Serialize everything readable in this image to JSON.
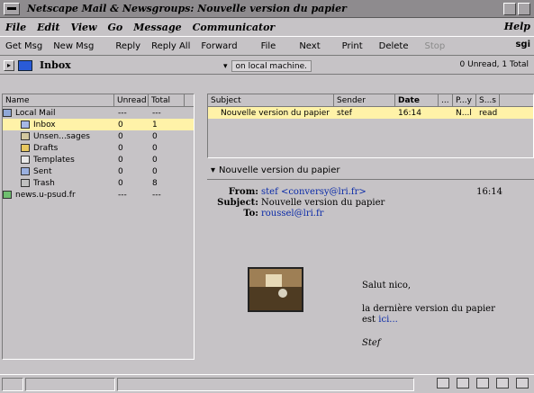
{
  "window": {
    "title": "Netscape Mail & Newsgroups: Nouvelle version du papier"
  },
  "menu": {
    "items": [
      "File",
      "Edit",
      "View",
      "Go",
      "Message",
      "Communicator"
    ],
    "help": "Help"
  },
  "toolbar": {
    "buttons": [
      "Get Msg",
      "New Msg",
      "Reply",
      "Reply All",
      "Forward",
      "File",
      "Next",
      "Print",
      "Delete",
      "Stop"
    ],
    "logo": "sgi"
  },
  "folderbar": {
    "folder": "Inbox",
    "host": "on local machine.",
    "counts": "0 Unread, 1 Total"
  },
  "folders": {
    "headers": [
      "Name",
      "Unread",
      "Total"
    ],
    "rows": [
      {
        "name": "Local Mail",
        "unread": "---",
        "total": "---"
      },
      {
        "name": "Inbox",
        "unread": "0",
        "total": "1"
      },
      {
        "name": "Unsen...sages",
        "unread": "0",
        "total": "0"
      },
      {
        "name": "Drafts",
        "unread": "0",
        "total": "0"
      },
      {
        "name": "Templates",
        "unread": "0",
        "total": "0"
      },
      {
        "name": "Sent",
        "unread": "0",
        "total": "0"
      },
      {
        "name": "Trash",
        "unread": "0",
        "total": "8"
      },
      {
        "name": "news.u-psud.fr",
        "unread": "---",
        "total": "---"
      }
    ]
  },
  "messages": {
    "headers": [
      "Subject",
      "Sender",
      "Date",
      "...",
      "P...y",
      "S...s"
    ],
    "row": {
      "subject": "Nouvelle version du papier",
      "sender": "stef",
      "date": "16:14",
      "priority": "N...l",
      "status": "read"
    }
  },
  "preview": {
    "header": "Nouvelle version du papier",
    "from_label": "From:",
    "from": "stef <conversy@lri.fr>",
    "time": "16:14",
    "subject_label": "Subject:",
    "subject": "Nouvelle version du papier",
    "to_label": "To:",
    "to": "roussel@lri.fr",
    "body": {
      "greeting": "Salut nico,",
      "line1": "la dernière version du papier",
      "line2": "est",
      "link": "ici...",
      "signature": "Stef"
    }
  },
  "colors": {
    "selection": "#fff2a8",
    "link": "#0a2aa8",
    "chrome": "#c6c3c6"
  }
}
